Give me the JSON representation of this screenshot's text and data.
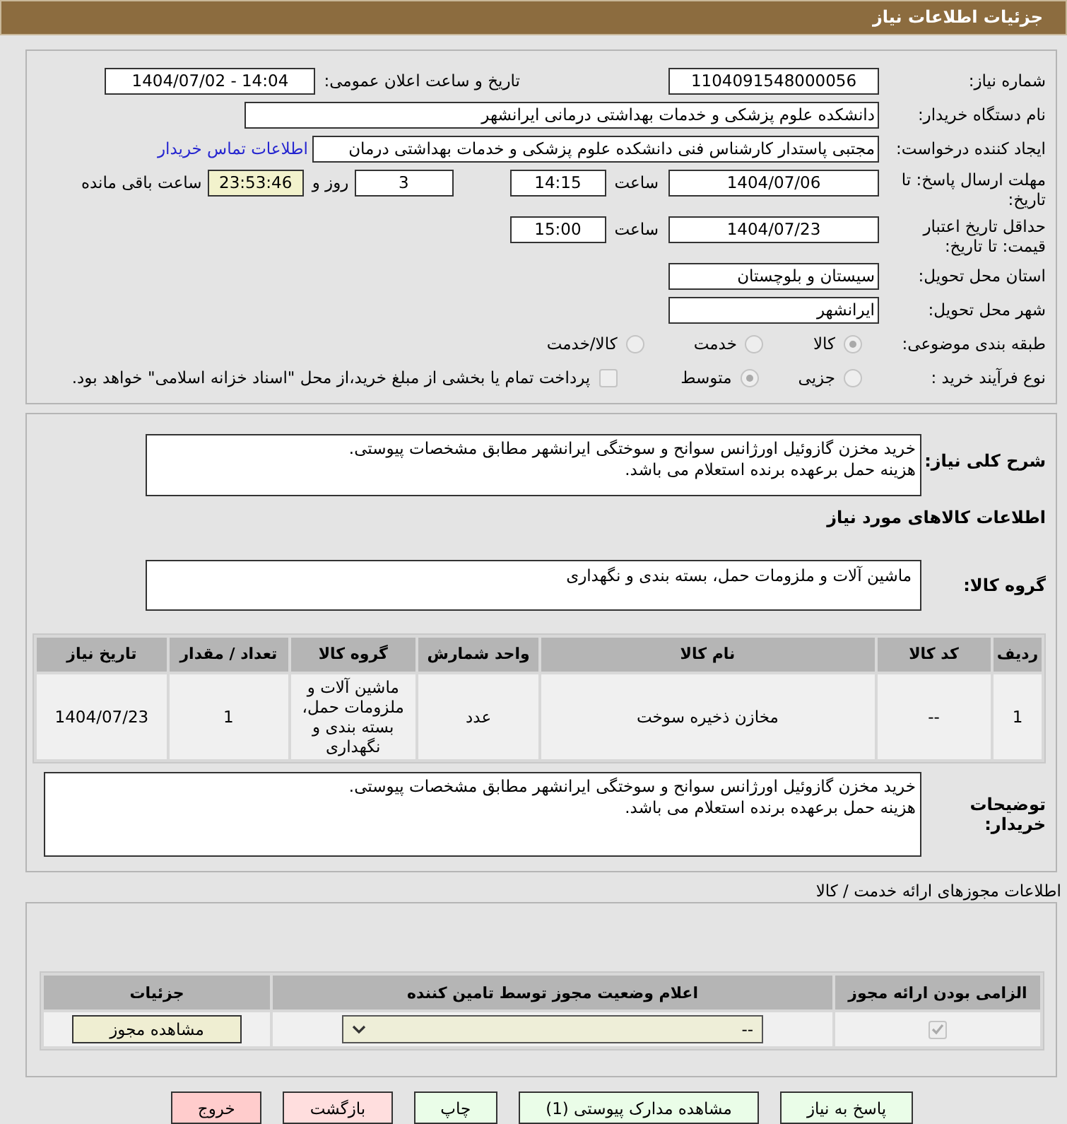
{
  "header": {
    "title": "جزئیات اطلاعات نیاز"
  },
  "need_number": {
    "label": "شماره نیاز:",
    "value": "1104091548000056"
  },
  "announce": {
    "label": "تاریخ و ساعت اعلان عمومی:",
    "value": "1404/07/02 - 14:04"
  },
  "buyer": {
    "label": "نام دستگاه خریدار:",
    "value": "دانشکده علوم پزشکی و خدمات بهداشتی درمانی ایرانشهر"
  },
  "creator": {
    "label": "ایجاد کننده درخواست:",
    "value": "مجتبی پاستدار کارشناس فنی دانشکده علوم پزشکی و خدمات بهداشتی درمان",
    "link": "اطلاعات تماس خریدار"
  },
  "deadline": {
    "label": "مهلت ارسال پاسخ: تا تاریخ:",
    "date": "1404/07/06",
    "time_label": "ساعت",
    "time": "14:15",
    "days": "3",
    "days_label": "روز و",
    "remaining": "23:53:46",
    "remaining_label": "ساعت باقی مانده"
  },
  "validity": {
    "label": "حداقل تاریخ اعتبار قیمت: تا تاریخ:",
    "date": "1404/07/23",
    "time_label": "ساعت",
    "time": "15:00"
  },
  "province": {
    "label": "استان محل تحویل:",
    "value": "سیستان و بلوچستان"
  },
  "city": {
    "label": "شهر محل تحویل:",
    "value": "ایرانشهر"
  },
  "category": {
    "label": "طبقه بندی موضوعی:",
    "options": [
      {
        "label": "کالا",
        "selected": true
      },
      {
        "label": "خدمت",
        "selected": false
      },
      {
        "label": "کالا/خدمت",
        "selected": false
      }
    ]
  },
  "process": {
    "label": "نوع فرآیند خرید :",
    "options": [
      {
        "label": "جزیی",
        "selected": false
      },
      {
        "label": "متوسط",
        "selected": true
      }
    ],
    "payment": {
      "label": "پرداخت تمام یا بخشی از مبلغ خرید،از محل \"اسناد خزانه اسلامی\" خواهد بود.",
      "checked": false
    }
  },
  "description": {
    "label": "شرح کلی نیاز:",
    "value": "خرید مخزن گازوئیل اورژانس سوانح و سوختگی ایرانشهر مطابق مشخصات پیوستی.\nهزینه حمل برعهده برنده استعلام می باشد."
  },
  "goods_heading": "اطلاعات کالاهای مورد نیاز",
  "goods_group": {
    "label": "گروه کالا:",
    "value": "ماشین آلات و ملزومات حمل، بسته بندی و نگهداری"
  },
  "goods_table": {
    "columns": [
      "ردیف",
      "کد کالا",
      "نام کالا",
      "واحد شمارش",
      "گروه کالا",
      "تعداد / مقدار",
      "تاریخ نیاز"
    ],
    "rows": [
      [
        "1",
        "--",
        "مخازن ذخیره سوخت",
        "عدد",
        "ماشین آلات و ملزومات حمل، بسته بندی و نگهداری",
        "1",
        "1404/07/23"
      ]
    ]
  },
  "buyer_notes": {
    "label": "توضیحات خریدار:",
    "value": "خرید مخزن گازوئیل اورژانس سوانح و سوختگی ایرانشهر مطابق مشخصات پیوستی.\nهزینه حمل برعهده برنده استعلام می باشد."
  },
  "permits": {
    "title": "اطلاعات مجوزهای ارائه خدمت / کالا",
    "columns": [
      "الزامی بودن ارائه مجوز",
      "اعلام وضعیت مجوز توسط تامین کننده",
      "جزئیات"
    ],
    "rows": [
      {
        "required": true,
        "status": "--",
        "details": "مشاهده مجوز"
      }
    ]
  },
  "buttons": [
    {
      "label": "پاسخ به نیاز",
      "kind": "normal"
    },
    {
      "label": "مشاهده مدارک پیوستی (1)",
      "kind": "normal"
    },
    {
      "label": "چاپ",
      "kind": "normal"
    },
    {
      "label": "بازگشت",
      "kind": "back"
    },
    {
      "label": "خروج",
      "kind": "exit"
    }
  ]
}
